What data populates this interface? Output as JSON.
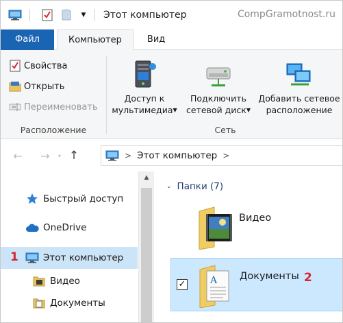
{
  "window": {
    "title": "Этот компьютер",
    "watermark": "CompGramotnost.ru"
  },
  "ribbon_tabs": [
    {
      "label": "Файл",
      "active": false
    },
    {
      "label": "Компьютер",
      "active": true
    },
    {
      "label": "Вид",
      "active": false
    }
  ],
  "ribbon": {
    "location_group": {
      "label": "Расположение",
      "commands": [
        {
          "label": "Свойства",
          "icon": "properties-check-icon",
          "enabled": true
        },
        {
          "label": "Открыть",
          "icon": "open-folder-icon",
          "enabled": true
        },
        {
          "label": "Переименовать",
          "icon": "rename-icon",
          "enabled": false
        }
      ]
    },
    "network_group": {
      "label": "Сеть",
      "commands": [
        {
          "line1": "Доступ к",
          "line2": "мультимедиа",
          "has_dropdown": true,
          "icon": "media-server-icon"
        },
        {
          "line1": "Подключить",
          "line2": "сетевой диск",
          "has_dropdown": true,
          "icon": "map-network-drive-icon"
        },
        {
          "line1": "Добавить сетевое",
          "line2": "расположение",
          "has_dropdown": false,
          "icon": "network-location-icon"
        }
      ]
    }
  },
  "address_bar": {
    "path": [
      "Этот компьютер"
    ]
  },
  "nav_pane": {
    "items": [
      {
        "label": "Быстрый доступ",
        "icon": "star-icon"
      },
      {
        "label": "OneDrive",
        "icon": "cloud-icon"
      },
      {
        "label": "Этот компьютер",
        "icon": "computer-icon",
        "selected": true,
        "marker": "1"
      },
      {
        "label": "Видео",
        "icon": "video-folder-icon"
      },
      {
        "label": "Документы",
        "icon": "documents-folder-icon"
      }
    ]
  },
  "content": {
    "group_header": "Папки (7)",
    "folders": [
      {
        "name": "Видео",
        "selected": false
      },
      {
        "name": "Документы",
        "selected": true,
        "checked": true,
        "marker": "2"
      }
    ]
  },
  "colors": {
    "accent": "#1a64b4",
    "selection": "#cce8ff",
    "marker": "#d4242a"
  }
}
